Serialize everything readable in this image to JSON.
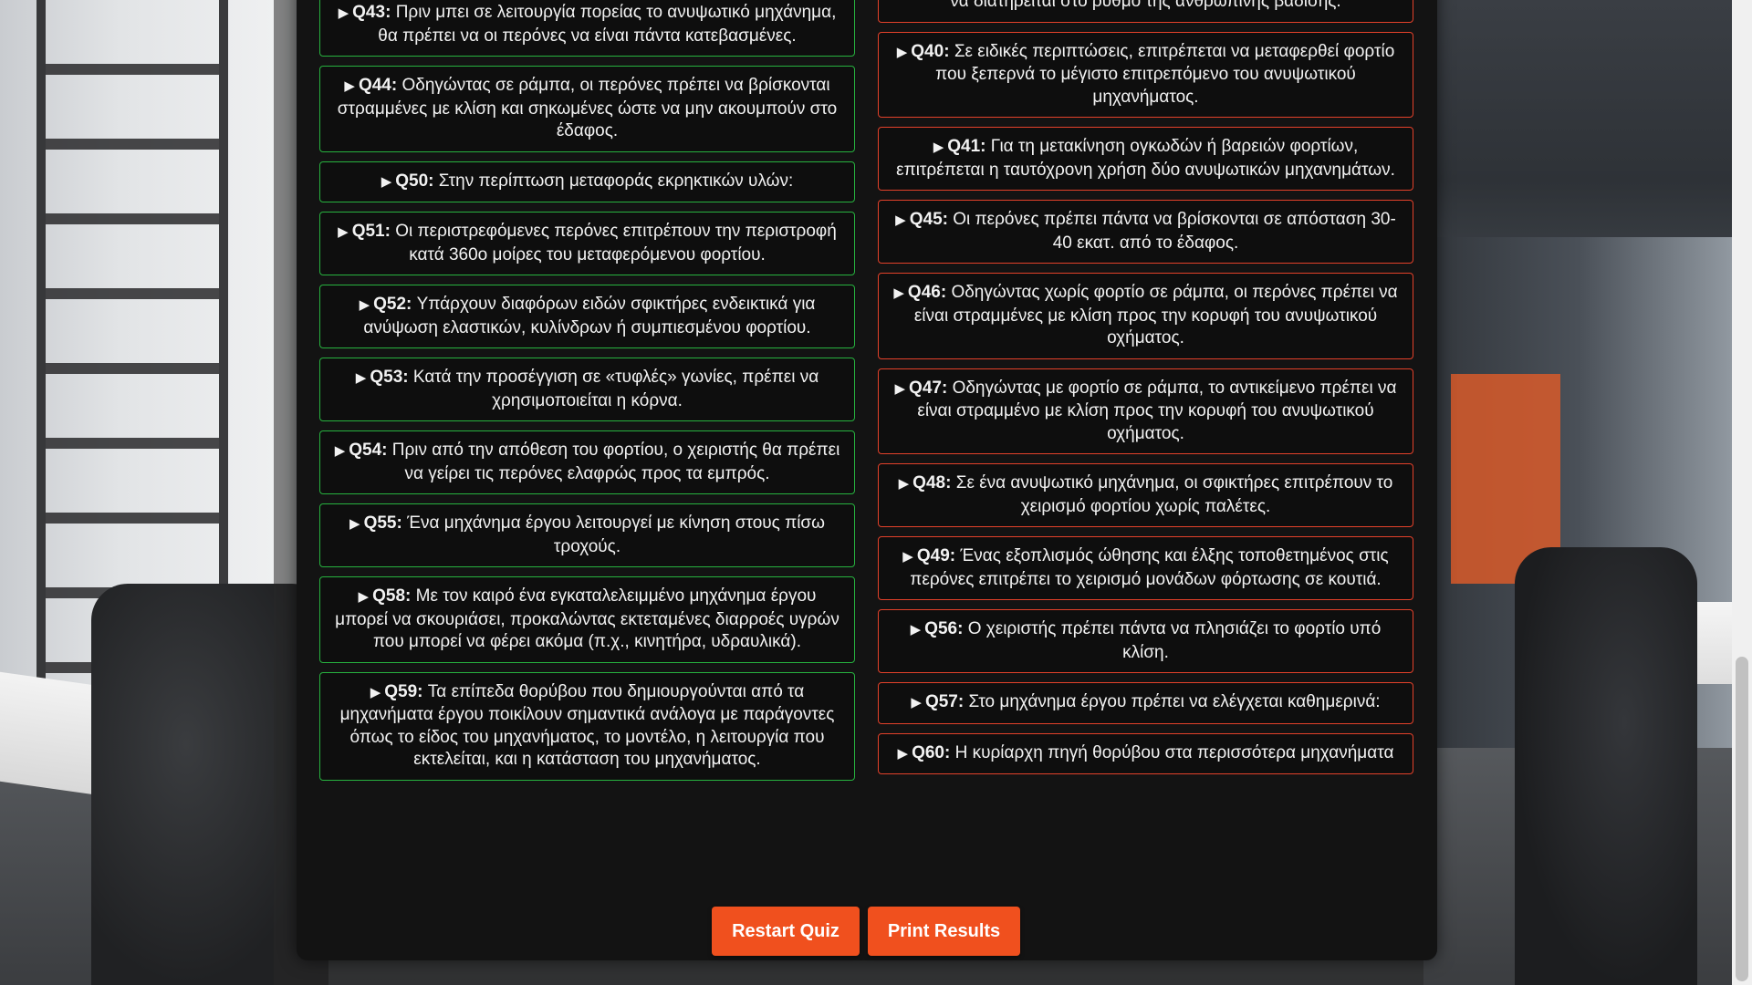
{
  "left_questions": [
    {
      "id": "Q43:",
      "text": "Πριν μπει σε λειτουργία πορείας το ανυψωτικό μηχάνημα, θα πρέπει να οι περόνες να είναι πάντα κατεβασμένες."
    },
    {
      "id": "Q44:",
      "text": "Οδηγώντας σε ράμπα, οι περόνες πρέπει να βρίσκονται στραμμένες με κλίση και σηκωμένες ώστε να μην ακουμπούν στο έδαφος."
    },
    {
      "id": "Q50:",
      "text": "Στην περίπτωση μεταφοράς εκρηκτικών υλών:"
    },
    {
      "id": "Q51:",
      "text": "Οι περιστρεφόμενες περόνες επιτρέπουν την περιστροφή κατά 360ο μοίρες του μεταφερόμενου φορτίου."
    },
    {
      "id": "Q52:",
      "text": "Υπάρχουν διαφόρων ειδών σφικτήρες ενδεικτικά για ανύψωση ελαστικών, κυλίνδρων ή συμπιεσμένου φορτίου."
    },
    {
      "id": "Q53:",
      "text": "Κατά την προσέγγιση σε «τυφλές» γωνίες, πρέπει να χρησιμοποιείται η κόρνα."
    },
    {
      "id": "Q54:",
      "text": "Πριν από την απόθεση του φορτίου, ο χειριστής θα πρέπει να γείρει τις περόνες ελαφρώς προς τα εμπρός."
    },
    {
      "id": "Q55:",
      "text": "Ένα μηχάνημα έργου λειτουργεί με κίνηση στους πίσω τροχούς."
    },
    {
      "id": "Q58:",
      "text": "Με τον καιρό ένα εγκαταλελειμμένο μηχάνημα έργου μπορεί να σκουριάσει, προκαλώντας εκτεταμένες διαρροές υγρών που μπορεί να φέρει ακόμα (π.χ., κινητήρα, υδραυλικά)."
    },
    {
      "id": "Q59:",
      "text": "Τα επίπεδα θορύβου που δημιουργούνται από τα μηχανήματα έργου ποικίλουν σημαντικά ανάλογα με παράγοντες όπως το είδος του μηχανήματος, το μοντέλο, η λειτουργία που εκτελείται, και η κατάσταση του μηχανήματος."
    }
  ],
  "right_questions": [
    {
      "id": "",
      "text": "να διατηρείται στο ρυθμό της ανθρώπινης βάδισης."
    },
    {
      "id": "Q40:",
      "text": "Σε ειδικές περιπτώσεις, επιτρέπεται να μεταφερθεί φορτίο που ξεπερνά το μέγιστο επιτρεπόμενο του ανυψωτικού μηχανήματος."
    },
    {
      "id": "Q41:",
      "text": "Για τη μετακίνηση ογκωδών ή βαρειών φορτίων, επιτρέπεται η ταυτόχρονη χρήση δύο ανυψωτικών μηχανημάτων."
    },
    {
      "id": "Q45:",
      "text": "Οι περόνες πρέπει πάντα να βρίσκονται σε απόσταση 30- 40 εκατ. από το έδαφος."
    },
    {
      "id": "Q46:",
      "text": "Οδηγώντας χωρίς φορτίο σε ράμπα, οι περόνες πρέπει να είναι στραμμένες με κλίση προς την κορυφή του ανυψωτικού οχήματος."
    },
    {
      "id": "Q47:",
      "text": "Οδηγώντας με φορτίο σε ράμπα, το αντικείμενο πρέπει να είναι στραμμένο με κλίση προς την κορυφή του ανυψωτικού οχήματος."
    },
    {
      "id": "Q48:",
      "text": "Σε ένα ανυψωτικό μηχάνημα, οι σφικτήρες επιτρέπουν το χειρισμό φορτίου χωρίς παλέτες."
    },
    {
      "id": "Q49:",
      "text": "Ένας εξοπλισμός ώθησης και έλξης τοποθετημένος στις περόνες επιτρέπει το χειρισμό μονάδων φόρτωσης σε κουτιά."
    },
    {
      "id": "Q56:",
      "text": "Ο χειριστής πρέπει πάντα να πλησιάζει το φορτίο υπό κλίση."
    },
    {
      "id": "Q57:",
      "text": "Στο μηχάνημα έργου πρέπει να ελέγχεται καθημερινά:"
    },
    {
      "id": "Q60:",
      "text": "Η κυρίαρχη πηγή θορύβου στα περισσότερα μηχανήματα"
    }
  ],
  "buttons": {
    "restart": "Restart Quiz",
    "print": "Print Results"
  },
  "icons": {
    "expand": "▶"
  },
  "colors": {
    "correct_border": "#27b23f",
    "wrong_border": "#e3412a",
    "button": "#f0501e"
  }
}
